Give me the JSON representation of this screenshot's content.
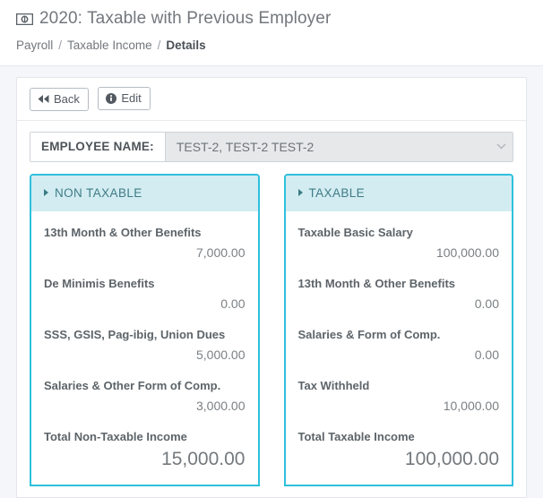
{
  "header": {
    "title": "2020: Taxable with Previous Employer",
    "title_icon": "money-bill-icon",
    "breadcrumb": [
      {
        "label": "Payroll",
        "current": false
      },
      {
        "label": "Taxable Income",
        "current": false
      },
      {
        "label": "Details",
        "current": true
      }
    ],
    "breadcrumb_separator": "/"
  },
  "toolbar": {
    "back_label": "Back",
    "back_icon": "fast-backward-icon",
    "edit_label": "Edit",
    "edit_icon": "info-circle-icon"
  },
  "employee_field": {
    "label": "EMPLOYEE NAME:",
    "value": "TEST-2, TEST-2 TEST-2",
    "caret_icon": "chevron-down-icon"
  },
  "panels": [
    {
      "title": "NON TAXABLE",
      "caret_icon": "caret-right-icon",
      "rows": [
        {
          "label": "13th Month & Other Benefits",
          "value": "7,000.00",
          "total": false
        },
        {
          "label": "De Minimis Benefits",
          "value": "0.00",
          "total": false
        },
        {
          "label": "SSS, GSIS, Pag-ibig, Union Dues",
          "value": "5,000.00",
          "total": false
        },
        {
          "label": "Salaries & Other Form of Comp.",
          "value": "3,000.00",
          "total": false
        },
        {
          "label": "Total Non-Taxable Income",
          "value": "15,000.00",
          "total": true
        }
      ]
    },
    {
      "title": "TAXABLE",
      "caret_icon": "caret-right-icon",
      "rows": [
        {
          "label": "Taxable Basic Salary",
          "value": "100,000.00",
          "total": false
        },
        {
          "label": "13th Month & Other Benefits",
          "value": "0.00",
          "total": false
        },
        {
          "label": "Salaries & Form of Comp.",
          "value": "0.00",
          "total": false
        },
        {
          "label": "Tax Withheld",
          "value": "10,000.00",
          "total": false
        },
        {
          "label": "Total Taxable Income",
          "value": "100,000.00",
          "total": true
        }
      ]
    }
  ],
  "colors": {
    "page_background": "#f4f6f9",
    "panel_border": "#2ec0dd",
    "panel_header_bg": "#d2ecf2",
    "panel_header_text": "#3f7b84",
    "text_muted": "#73777c"
  }
}
